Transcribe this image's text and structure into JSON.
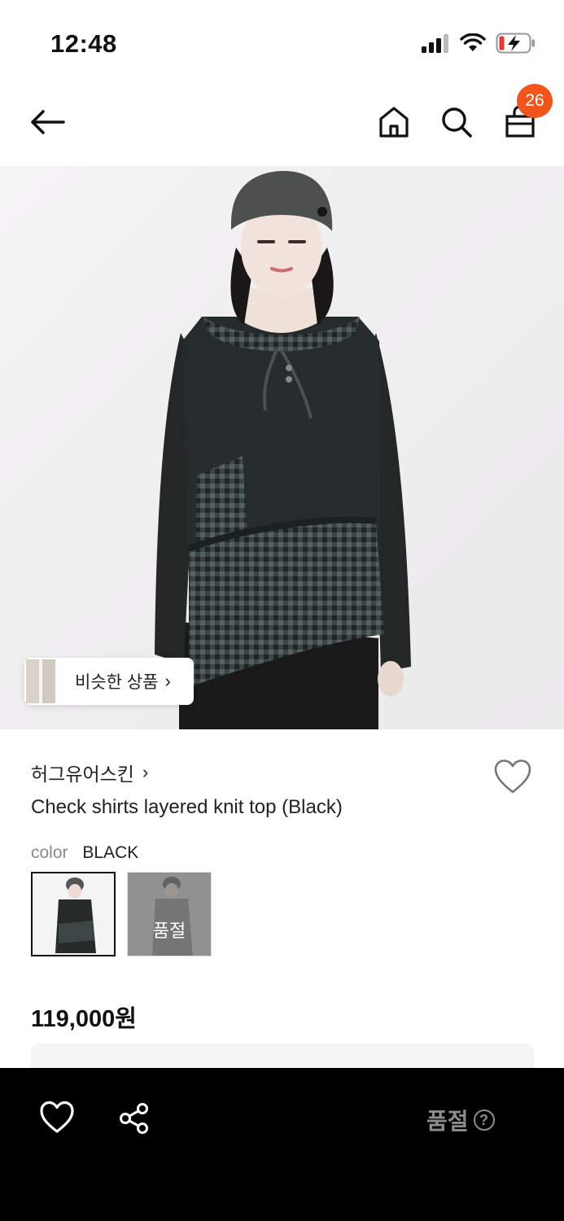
{
  "status_bar": {
    "time": "12:48"
  },
  "nav": {
    "cart_count": "26"
  },
  "hero": {
    "similar_label": "비슷한 상품"
  },
  "product": {
    "brand": "허그유어스킨",
    "title": "Check shirts layered knit top (Black)",
    "color_key": "color",
    "color_value": "BLACK",
    "soldout_overlay": "품절",
    "price": "119,000원"
  },
  "bottom_bar": {
    "soldout_label": "품절",
    "help_glyph": "?"
  },
  "icons": [
    "back-arrow-icon",
    "home-icon",
    "search-icon",
    "shopping-bag-icon",
    "heart-icon",
    "share-icon",
    "chevron-right-icon",
    "signal-icon",
    "wifi-icon",
    "battery-charging-icon",
    "help-icon"
  ],
  "colors": {
    "accent": "#f2551c",
    "bottom_bar": "#000000",
    "soldout_text": "#8c8c8c"
  }
}
